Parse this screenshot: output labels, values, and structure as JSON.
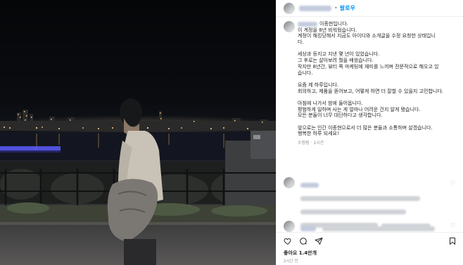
{
  "header": {
    "username": "",
    "dot": "•",
    "follow_label": "팔로우"
  },
  "caption": {
    "lines": [
      "이종현입니다.",
      "이 계정을 8년 비워뒀습니다.",
      "계정이 해킹당해서 지금도 아이디와 소개글을 수정 요청한 상태입니",
      "다.",
      "",
      "세상과 등지고 지낸 몇 년이 있었습니다.",
      "그 후로는 살아보려 뭘을 배웠습니다.",
      "작지만 8년간, 뷰티 쪽 마케팅에 재미를 느끼며 전문적으로 해오고 있",
      "습니다.",
      "",
      "요즘 제 하루입니다.",
      "회의하고, 제품을 뜯어보고, 어떻게 하면 더 잘할 수 있을지 고민합니다.",
      "",
      "아침에 나가서 밤에 들어옵니다.",
      "평범하게 일하며 사는 게 얼마나 어려운 건지 알게 됐습니다.",
      "모든 분들이 너무 대단하다고 생각합니다.",
      "",
      "앞으로는 인간 이종현으로서 더 많은 분들과 소통하며 살겠습니다.",
      "행복한 하루 되세요!"
    ],
    "meta_edited": "수정됨",
    "meta_sep": "·",
    "meta_time": "1시간"
  },
  "actions": {
    "like_icon": "heart-outline-icon",
    "comment_icon": "speech-bubble-icon",
    "share_icon": "paper-plane-icon",
    "save_icon": "bookmark-icon"
  },
  "likes_text": "좋아요 1.4만개",
  "posted_time": "2시간 전"
}
